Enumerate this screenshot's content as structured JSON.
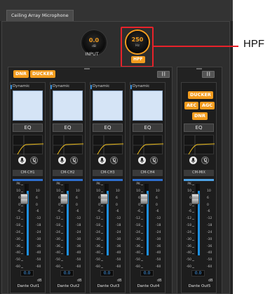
{
  "window": {
    "tab_title": "Ceiling Array Microphone"
  },
  "input": {
    "knob_value": "0.0",
    "knob_unit": "dB",
    "label": "INPUT"
  },
  "hpf_knob": {
    "value": "250",
    "unit": "Hz",
    "button_label": "HPF"
  },
  "mixer_group": {
    "dnr_label": "DNR",
    "ducker_label": "DUCKER",
    "matrix_icon_label": "║║"
  },
  "callout": {
    "label": "HPF"
  },
  "scale": {
    "marks": [
      "PK",
      "10",
      "6",
      "0",
      "-6",
      "-12",
      "-18",
      "-24",
      "-30",
      "-36",
      "-40",
      "-50",
      "-60"
    ]
  },
  "channels": [
    {
      "title": "Dynamic",
      "eq_label": "EQ",
      "name": "CM-CH1",
      "fader_value": "0.0",
      "unit": "dB",
      "output": "Dante Out1",
      "level_fraction": 0.9
    },
    {
      "title": "Dynamic",
      "eq_label": "EQ",
      "name": "CM-CH2",
      "fader_value": "0.0",
      "unit": "dB",
      "output": "Dante Out2",
      "level_fraction": 0.9
    },
    {
      "title": "Dynamic",
      "eq_label": "EQ",
      "name": "CM-CH3",
      "fader_value": "0.0",
      "unit": "dB",
      "output": "Dante Out3",
      "level_fraction": 0.9
    },
    {
      "title": "Dynamic",
      "eq_label": "EQ",
      "name": "CM-CH4",
      "fader_value": "0.0",
      "unit": "dB",
      "output": "Dante Out4",
      "level_fraction": 0.9
    }
  ],
  "mix": {
    "ducker_label": "DUCKER",
    "aec_label": "AEC",
    "agc_label": "AGC",
    "dnr_label": "DNR",
    "eq_label": "EQ",
    "name": "CM-MIX",
    "fader_value": "0.0",
    "unit": "dB",
    "output": "Dante Out5",
    "level_fraction": 0.9
  },
  "colors": {
    "accent": "#f39c1e",
    "highlight": "#e8222a",
    "meter": "#1d8fe0",
    "screen": "#d5e4f6"
  }
}
